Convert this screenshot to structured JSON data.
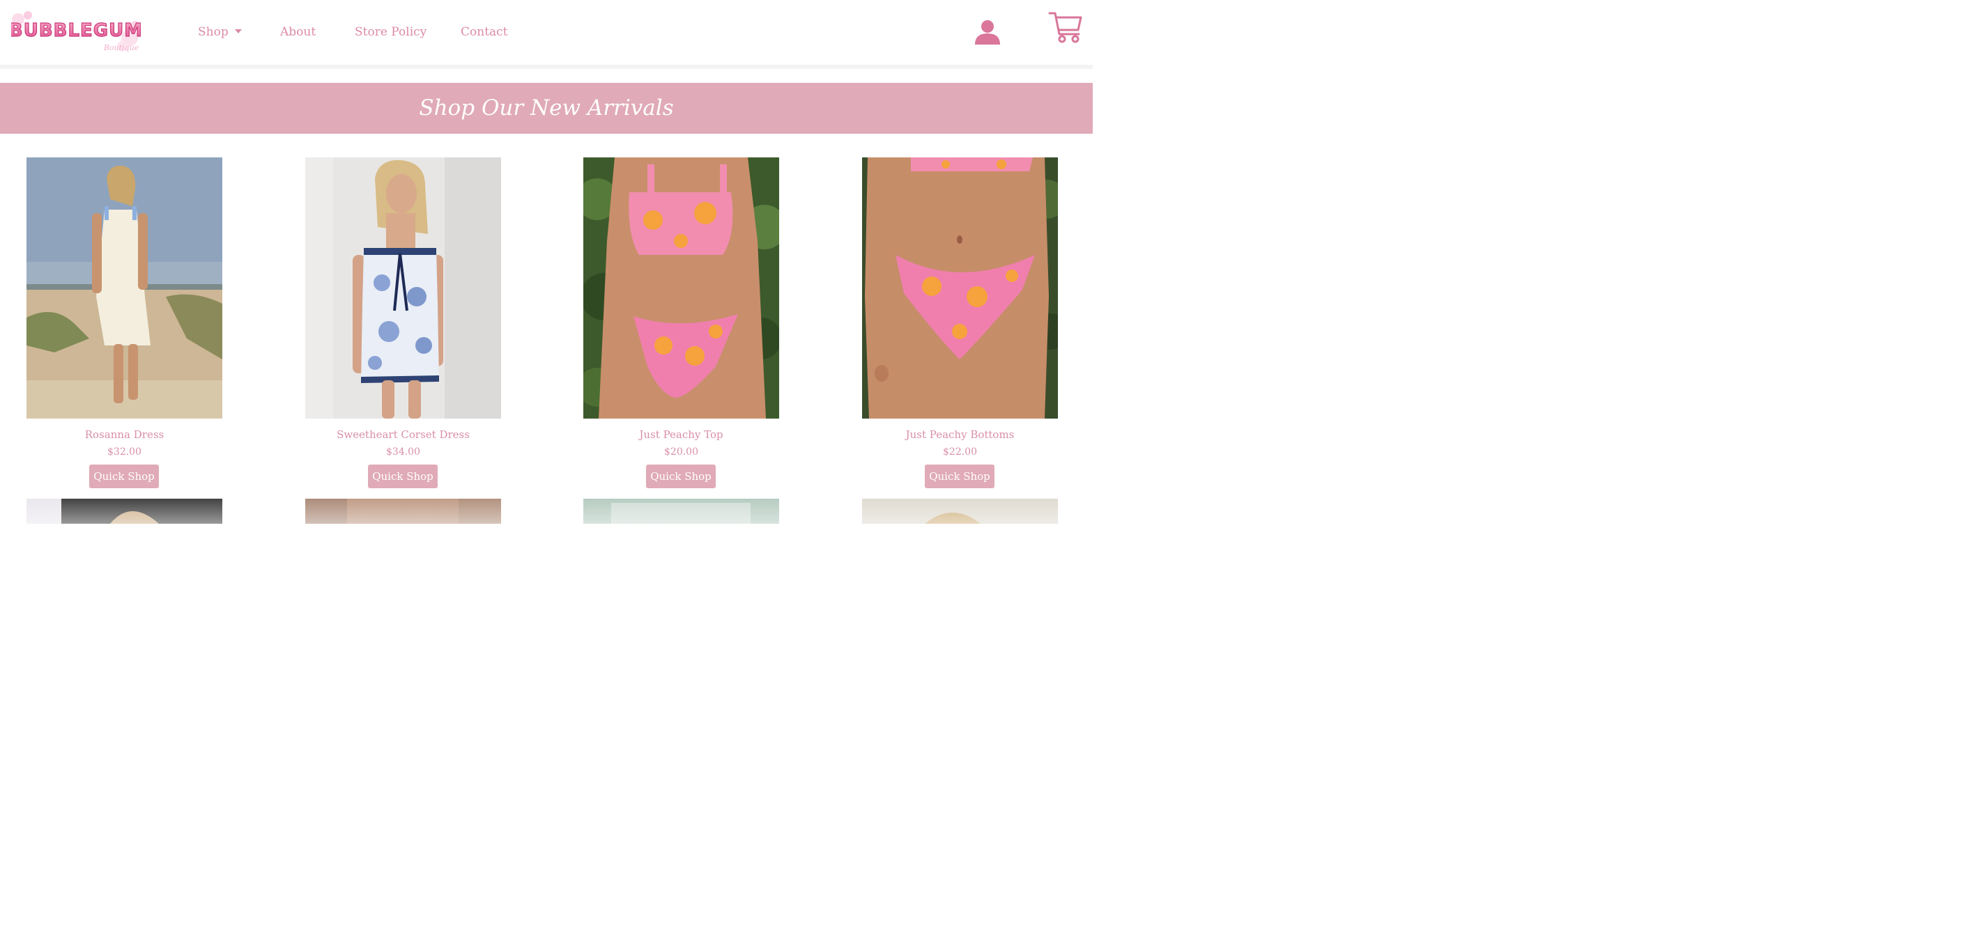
{
  "brand": {
    "logo_text": "BUBBLEGUM",
    "logo_script": "Boutique"
  },
  "nav": {
    "shop": "Shop",
    "about": "About",
    "store_policy": "Store Policy",
    "contact": "Contact"
  },
  "icons": {
    "account": "user-icon",
    "cart": "shopping-cart-icon"
  },
  "banner": {
    "title": "Shop Our New Arrivals"
  },
  "products": [
    {
      "name": "Rosanna Dress",
      "price": "$32.00",
      "button": "Quick Shop"
    },
    {
      "name": "Sweetheart Corset Dress",
      "price": "$34.00",
      "button": "Quick Shop"
    },
    {
      "name": "Just Peachy Top",
      "price": "$20.00",
      "button": "Quick Shop"
    },
    {
      "name": "Just Peachy Bottoms",
      "price": "$22.00",
      "button": "Quick Shop"
    }
  ],
  "colors": {
    "accent": "#e0aab8",
    "text": "#d98fa8",
    "logo_pink": "#e8679b"
  }
}
